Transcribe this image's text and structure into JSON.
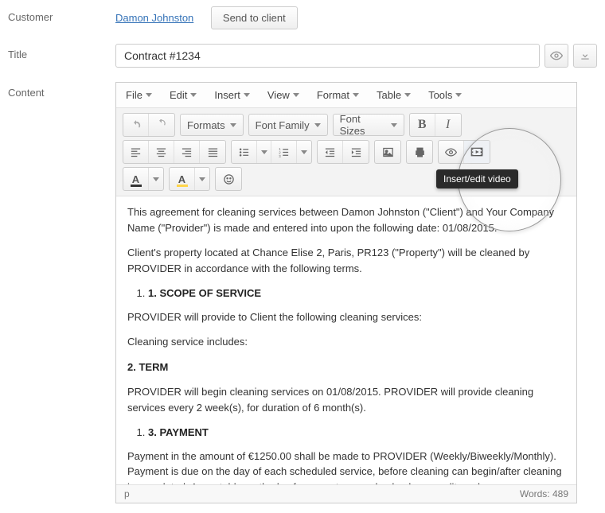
{
  "labels": {
    "customer": "Customer",
    "title": "Title",
    "content": "Content"
  },
  "customer": {
    "name": "Damon Johnston",
    "send_button": "Send to client"
  },
  "title_value": "Contract #1234",
  "menubar": {
    "file": "File",
    "edit": "Edit",
    "insert": "Insert",
    "view": "View",
    "format": "Format",
    "table": "Table",
    "tools": "Tools"
  },
  "toolbar": {
    "formats": "Formats",
    "font_family": "Font Family",
    "font_sizes": "Font Sizes",
    "text_color": "A",
    "bg_color": "A",
    "bold": "B",
    "italic": "I"
  },
  "tooltip": "Insert/edit video",
  "statusbar": {
    "path": "p",
    "words_label": "Words:",
    "words_count": "489"
  },
  "body": {
    "p1": "This agreement for cleaning services between Damon Johnston (\"Client\") and Your Company Name (\"Provider\") is made and entered into upon the following date: 01/08/2015.",
    "p2": "Client's property located at Chance Elise 2, Paris, PR123 (\"Property\") will be cleaned by PROVIDER in accordance with the following terms.",
    "h1": "1. SCOPE OF SERVICE",
    "p3": "PROVIDER will provide to Client the following cleaning services:",
    "p4": "Cleaning service includes:",
    "h2": "2. TERM",
    "p5": "PROVIDER will begin cleaning services on 01/08/2015. PROVIDER will provide cleaning services every 2 week(s), for duration of 6 month(s).",
    "h3": "3. PAYMENT",
    "p6a": "Payment in the amount of ",
    "p6_amount": "€1250.00",
    "p6b": " shall be made to PROVIDER (Weekly/Biweekly/Monthly). Payment is due on the day of each scheduled service, before cleaning can begin/after cleaning is completed. Acceptable methods of payment are cash, check, or credit card."
  }
}
